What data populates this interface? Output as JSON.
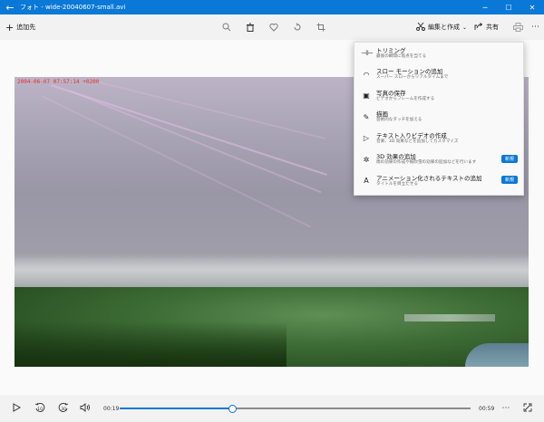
{
  "window": {
    "title": "フォト - wide-20040607-small.avi",
    "back_glyph": "←",
    "minimize_glyph": "─",
    "maximize_glyph": "☐",
    "close_glyph": "✕"
  },
  "toolbar": {
    "add_label": "追加先",
    "edit_create_label": "編集と作成",
    "share_label": "共有",
    "icons": [
      "zoom-icon",
      "delete-icon",
      "favorite-icon",
      "rotate-icon",
      "crop-icon",
      "edit-create-icon",
      "share-icon",
      "print-icon",
      "more-icon"
    ]
  },
  "video": {
    "timestamp": "2004-06-07 07:57:14 +0200"
  },
  "menu": {
    "items": [
      {
        "title": "トリミング",
        "desc": "最後の瞬間に焦点を当てる",
        "icon": "trim-icon",
        "badge": ""
      },
      {
        "title": "スロー モーションの追加",
        "desc": "スーパー スローからリアルタイムまで",
        "icon": "slow-motion-icon",
        "badge": ""
      },
      {
        "title": "写真の保存",
        "desc": "ビデオからフレームを作成する",
        "icon": "save-photo-icon",
        "badge": ""
      },
      {
        "title": "描画",
        "desc": "芸術的なタッチを加える",
        "icon": "draw-icon",
        "badge": ""
      },
      {
        "title": "テキスト入りビデオの作成",
        "desc": "音楽、3D 効果などを追加してカスタマイズ",
        "icon": "text-video-icon",
        "badge": ""
      },
      {
        "title": "3D 効果の追加",
        "desc": "雨の効果の作成や紙吹雪の効果の追加などを行います",
        "icon": "3d-effects-icon",
        "badge": "新規"
      },
      {
        "title": "アニメーション化されるテキストの追加",
        "desc": "タイトルを目立たせる",
        "icon": "animated-text-icon",
        "badge": "新規"
      }
    ]
  },
  "player": {
    "current_time": "00:19",
    "duration": "00:59",
    "progress": 0.32
  },
  "colors": {
    "accent": "#0a78d7",
    "timestamp": "#e0322c"
  }
}
